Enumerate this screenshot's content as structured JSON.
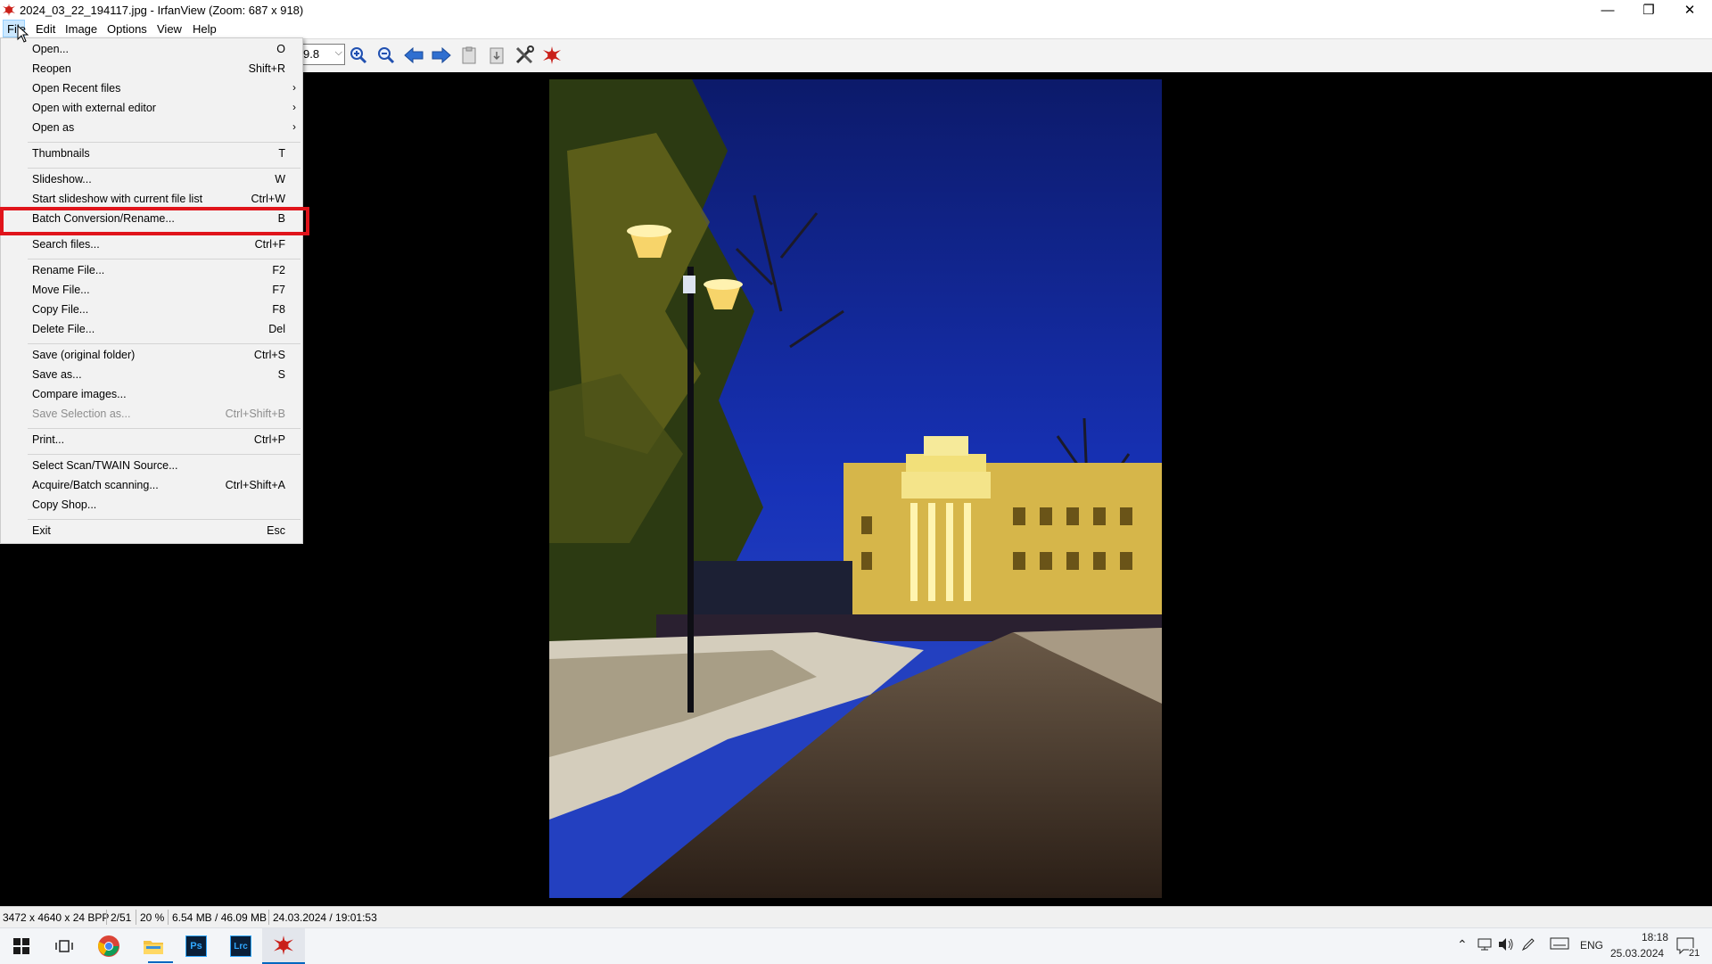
{
  "window": {
    "title": "2024_03_22_194117.jpg - IrfanView (Zoom: 687 x 918)",
    "minimize_symbol": "—",
    "maximize_symbol": "❐",
    "close_symbol": "✕"
  },
  "menubar": {
    "items": [
      "File",
      "Edit",
      "Image",
      "Options",
      "View",
      "Help"
    ]
  },
  "toolbar": {
    "zoom_value": "9.8",
    "icons": [
      "zoom-in-icon",
      "zoom-out-icon",
      "previous-icon",
      "next-icon",
      "copy-icon",
      "paste-icon",
      "settings-icon",
      "irfanview-icon"
    ]
  },
  "file_menu": {
    "items": [
      {
        "label": "Open...",
        "shortcut": "O"
      },
      {
        "label": "Reopen",
        "shortcut": "Shift+R"
      },
      {
        "label": "Open Recent files",
        "shortcut": "",
        "submenu": true
      },
      {
        "label": "Open with external editor",
        "shortcut": "",
        "submenu": true
      },
      {
        "label": "Open as",
        "shortcut": "",
        "submenu": true
      },
      {
        "label": "Thumbnails",
        "shortcut": "T"
      },
      {
        "label": "Slideshow...",
        "shortcut": "W"
      },
      {
        "label": "Start slideshow with current file list",
        "shortcut": "Ctrl+W"
      },
      {
        "label": "Batch Conversion/Rename...",
        "shortcut": "B"
      },
      {
        "label": "Search files...",
        "shortcut": "Ctrl+F"
      },
      {
        "label": "Rename File...",
        "shortcut": "F2"
      },
      {
        "label": "Move File...",
        "shortcut": "F7"
      },
      {
        "label": "Copy File...",
        "shortcut": "F8"
      },
      {
        "label": "Delete File...",
        "shortcut": "Del"
      },
      {
        "label": "Save (original folder)",
        "shortcut": "Ctrl+S"
      },
      {
        "label": "Save as...",
        "shortcut": "S"
      },
      {
        "label": "Compare images...",
        "shortcut": ""
      },
      {
        "label": "Save Selection as...",
        "shortcut": "Ctrl+Shift+B",
        "disabled": true
      },
      {
        "label": "Print...",
        "shortcut": "Ctrl+P"
      },
      {
        "label": "Select Scan/TWAIN Source...",
        "shortcut": ""
      },
      {
        "label": "Acquire/Batch scanning...",
        "shortcut": "Ctrl+Shift+A"
      },
      {
        "label": "Copy Shop...",
        "shortcut": ""
      },
      {
        "label": "Exit",
        "shortcut": "Esc"
      }
    ],
    "highlighted_item": "Batch Conversion/Rename...",
    "highlight_color": "#e0141b"
  },
  "statusbar": {
    "dimensions": "3472 x 4640 x 24 BPP",
    "position": "2/51",
    "zoom": "20 %",
    "filesize": "6.54 MB / 46.09 MB",
    "datetime": "24.03.2024 / 19:01:53"
  },
  "taskbar": {
    "apps": [
      "windows-start-icon",
      "task-view-icon",
      "chrome-icon",
      "file-explorer-icon",
      "photoshop-icon",
      "lightroom-classic-icon",
      "irfanview-icon"
    ],
    "photoshop_label": "Ps",
    "lightroom_label": "Lrc",
    "language": "ENG",
    "time": "18:18",
    "date": "25.03.2024",
    "notification_count": "21"
  }
}
